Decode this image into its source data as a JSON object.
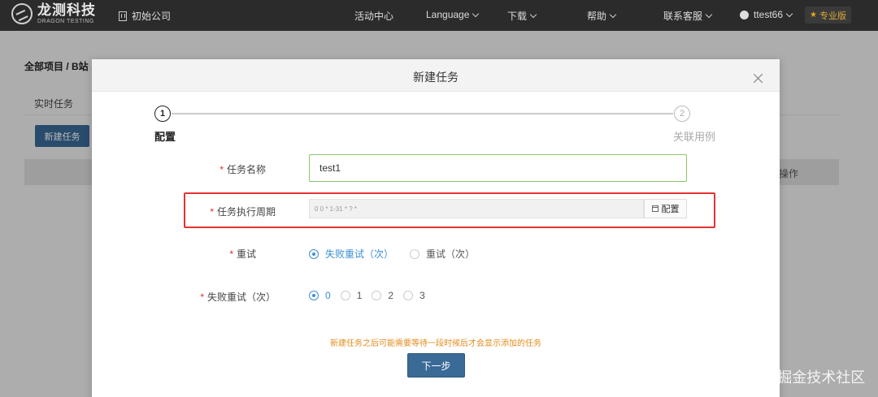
{
  "topbar": {
    "logo_cn": "龙测科技",
    "logo_en": "DRAGON TESTING",
    "company": "初始公司",
    "nav": {
      "activity": "活动中心",
      "language": "Language",
      "download": "下载",
      "help": "帮助",
      "support": "联系客服",
      "user": "ttest66"
    },
    "pro_badge": "专业版"
  },
  "background": {
    "breadcrumb": "全部项目 / B站",
    "tab": "实时任务",
    "new_task_button": "新建任务",
    "operation_header": "操作"
  },
  "modal": {
    "title": "新建任务",
    "steps": [
      {
        "number": "1",
        "label": "配置"
      },
      {
        "number": "2",
        "label": "关联用例"
      }
    ],
    "fields": {
      "task_name_label": "任务名称",
      "task_name_value": "test1",
      "cycle_label": "任务执行周期",
      "cycle_value": "0 0 * 1-31 * ? *",
      "config_button": "配置",
      "retry_label": "重试",
      "retry_options": [
        "失败重试（次）",
        "重试（次）"
      ],
      "retry_selected": 0,
      "fail_retry_label": "失败重试（次）",
      "fail_retry_options": [
        "0",
        "1",
        "2",
        "3"
      ],
      "fail_retry_selected": 0
    },
    "hint": "新建任务之后可能需要等待一段时候后才会显示添加的任务",
    "next_button": "下一步"
  },
  "watermark": "@稀土掘金技术社区"
}
